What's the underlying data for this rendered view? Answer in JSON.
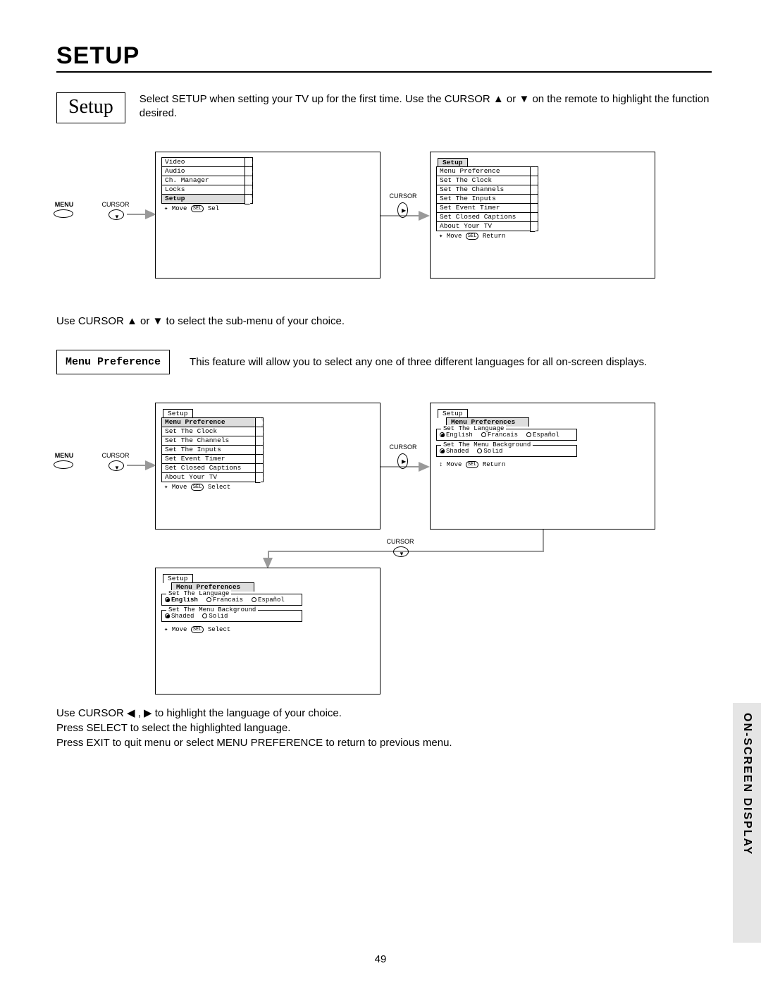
{
  "page_title": "SETUP",
  "setup_box": "Setup",
  "intro": "Select SETUP when setting your TV up for the first time.  Use the CURSOR ▲ or ▼ on the remote to highlight the function desired.",
  "labels": {
    "menu": "MENU",
    "cursor": "CURSOR"
  },
  "screen1": {
    "items": [
      "Video",
      "Audio",
      "Ch. Manager",
      "Locks",
      "Setup"
    ],
    "hl_index": 4,
    "hint_move": "Move",
    "hint_sel": "Sel"
  },
  "screen2": {
    "tab": "Setup",
    "items": [
      "Menu Preference",
      "Set The Clock",
      "Set The Channels",
      "Set The Inputs",
      "Set Event Timer",
      "Set Closed Captions",
      "About Your TV"
    ],
    "hint_move": "Move",
    "hint_ret": "Return"
  },
  "mid_text": "Use CURSOR ▲ or ▼ to select the sub-menu of your choice.",
  "menupref_box": "Menu Preference",
  "menupref_text": "This feature will allow you to select any one of three different languages for all on-screen displays.",
  "screen3": {
    "tab": "Setup",
    "items": [
      "Menu Preference",
      "Set The Clock",
      "Set The Channels",
      "Set The Inputs",
      "Set Event Timer",
      "Set Closed Captions",
      "About Your TV"
    ],
    "hl_index": 0,
    "hint_move": "Move",
    "hint_sel": "Select"
  },
  "screen4": {
    "tab": "Setup",
    "subtab": "Menu Preferences",
    "lang_legend": "Set The Language",
    "langs": [
      "English",
      "Francais",
      "Español"
    ],
    "lang_sel": 0,
    "bg_legend": "Set The Menu Background",
    "bgs": [
      "Shaded",
      "Solid"
    ],
    "bg_sel": 0,
    "hint_move": "Move",
    "hint_ret": "Return"
  },
  "screen5": {
    "tab": "Setup",
    "subtab": "Menu Preferences",
    "lang_legend": "Set The Language",
    "langs": [
      "English",
      "Francais",
      "Español"
    ],
    "lang_sel": 0,
    "lang_bold": 0,
    "bg_legend": "Set The Menu Background",
    "bgs": [
      "Shaded",
      "Solid"
    ],
    "bg_sel": 0,
    "hint_move": "Move",
    "hint_sel": "Select"
  },
  "footer_lines": [
    "Use CURSOR ◀ , ▶ to highlight the language of your choice.",
    "Press SELECT to select the highlighted language.",
    "Press EXIT to quit menu or select MENU PREFERENCE to return to previous menu."
  ],
  "sidebar": "ON-SCREEN DISPLAY",
  "page_number": "49"
}
